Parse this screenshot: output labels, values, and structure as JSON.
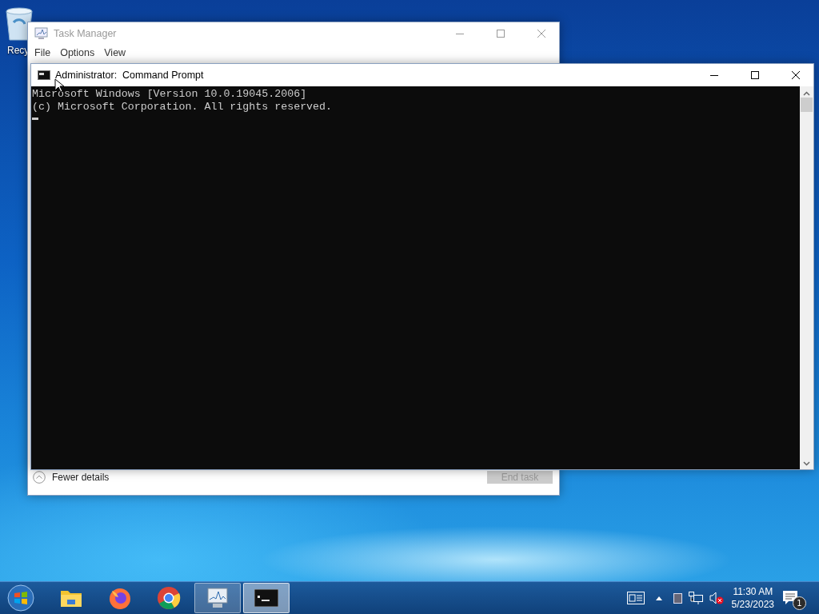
{
  "desktop": {
    "icons": [
      {
        "kind": "recycle_bin",
        "label": "Recy"
      }
    ]
  },
  "task_manager": {
    "title": "Task Manager",
    "menu": [
      "File",
      "Options",
      "View"
    ],
    "details_toggle": "Fewer details",
    "end_task": {
      "label": "End task",
      "disabled": true
    }
  },
  "command_prompt": {
    "title": "Administrator:  Command Prompt",
    "lines": [
      "Microsoft Windows [Version 10.0.19045.2006]",
      "(c) Microsoft Corporation. All rights reserved."
    ]
  },
  "taskbar": {
    "apps": [
      {
        "kind": "explorer",
        "selected": false
      },
      {
        "kind": "firefox",
        "selected": false
      },
      {
        "kind": "chrome",
        "selected": false
      },
      {
        "kind": "taskmgr",
        "selected": false
      },
      {
        "kind": "cmd",
        "selected": true
      }
    ],
    "tray": {
      "time": "11:30 AM",
      "date": "5/23/2023",
      "notifications": "1"
    }
  }
}
